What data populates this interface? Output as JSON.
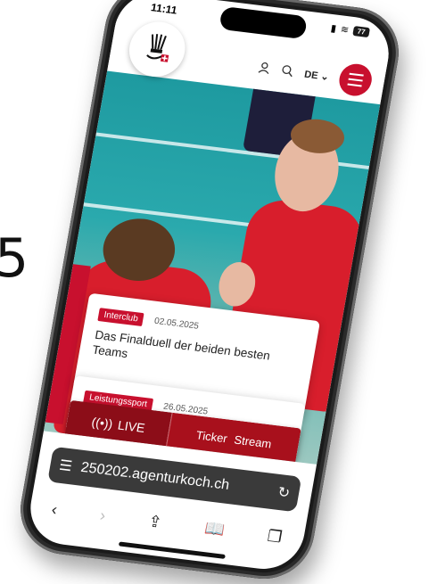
{
  "background_text": "5",
  "status_bar": {
    "time": "11:11",
    "battery": "77"
  },
  "header": {
    "language": "DE"
  },
  "articles": [
    {
      "tag": "Interclub",
      "date": "02.05.2025",
      "title": "Das Finalduell der beiden besten Teams"
    },
    {
      "tag": "Leistungssport",
      "date": "26.05.2025"
    }
  ],
  "cta": {
    "live_label": "LIVE",
    "ticker_label": "Ticker",
    "stream_label": "Stream"
  },
  "browser": {
    "url": "250202.agenturkoch.ch"
  },
  "colors": {
    "brand_red": "#c8102e",
    "live_dark_red": "#8c0d18"
  }
}
